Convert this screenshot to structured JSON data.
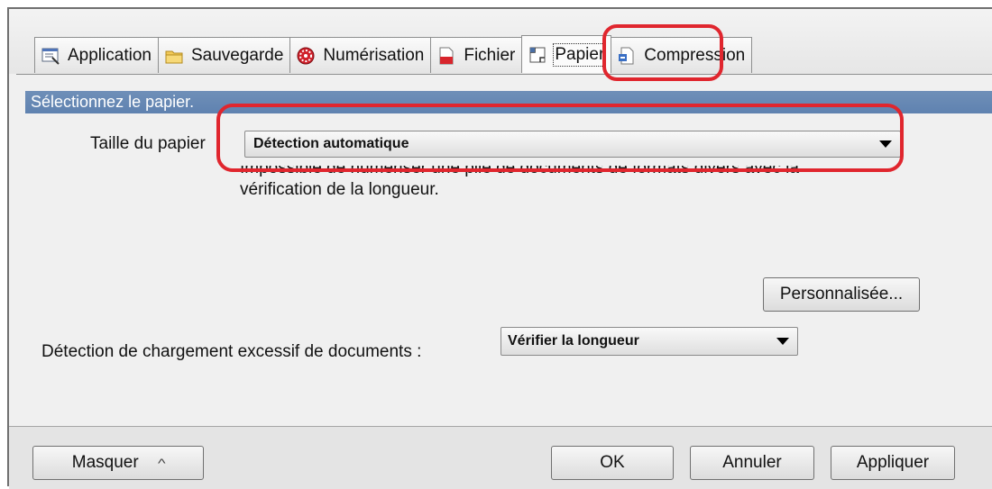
{
  "tabs": [
    {
      "label": "Application",
      "icon": "application-icon",
      "active": false
    },
    {
      "label": "Sauvegarde",
      "icon": "folder-icon",
      "active": false
    },
    {
      "label": "Numérisation",
      "icon": "scan-icon",
      "active": false
    },
    {
      "label": "Fichier",
      "icon": "file-icon",
      "active": false
    },
    {
      "label": "Papier",
      "icon": "paper-icon",
      "active": true
    },
    {
      "label": "Compression",
      "icon": "compression-icon",
      "active": false
    }
  ],
  "panel": {
    "header": "Sélectionnez le papier.",
    "paper_size_label": "Taille du papier",
    "paper_size_value": "Détection automatique",
    "note_line1": "Impossible de numériser une pile de documents de formats divers avec la",
    "note_line2": "vérification de la longueur.",
    "custom_button": "Personnalisée...",
    "overload_label": "Détection de chargement excessif de documents :",
    "overload_value": "Vérifier la longueur"
  },
  "footer": {
    "hide_button": "Masquer",
    "ok_button": "OK",
    "cancel_button": "Annuler",
    "apply_button": "Appliquer"
  },
  "colors": {
    "section_header": "#5f82b0",
    "highlight": "#e0262e"
  }
}
